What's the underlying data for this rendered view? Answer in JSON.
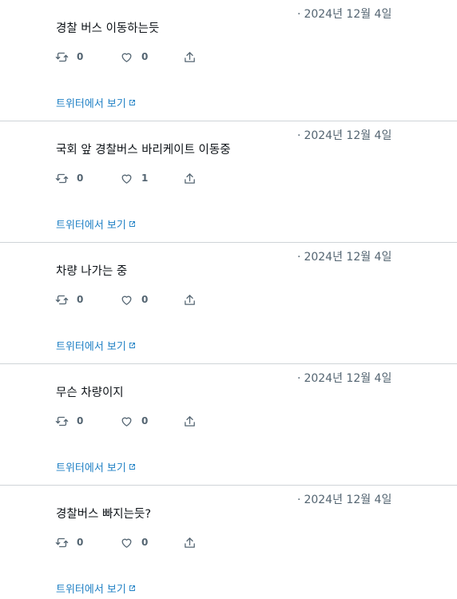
{
  "tweets": [
    {
      "date": "2024년 12월 4일",
      "text": "경찰 버스 이동하는듯",
      "retweets": "0",
      "likes": "0"
    },
    {
      "date": "2024년 12월 4일",
      "text": "국회 앞 경찰버스 바리케이트 이동중",
      "retweets": "0",
      "likes": "1"
    },
    {
      "date": "2024년 12월 4일",
      "text": "차량 나가는 중",
      "retweets": "0",
      "likes": "0"
    },
    {
      "date": "2024년 12월 4일",
      "text": "무슨 차량이지",
      "retweets": "0",
      "likes": "0"
    },
    {
      "date": "2024년 12월 4일",
      "text": "경찰버스 빠지는듯?",
      "retweets": "0",
      "likes": "0"
    }
  ],
  "date_prefix": "·",
  "view_link_label": "트위터에서 보기",
  "icons": {
    "retweet": "retweet-icon",
    "like": "heart-icon",
    "share": "share-icon",
    "external": "external-link-icon"
  },
  "colors": {
    "link": "#1d7fc4",
    "muted": "#536471",
    "divider": "#cfd4d8"
  }
}
